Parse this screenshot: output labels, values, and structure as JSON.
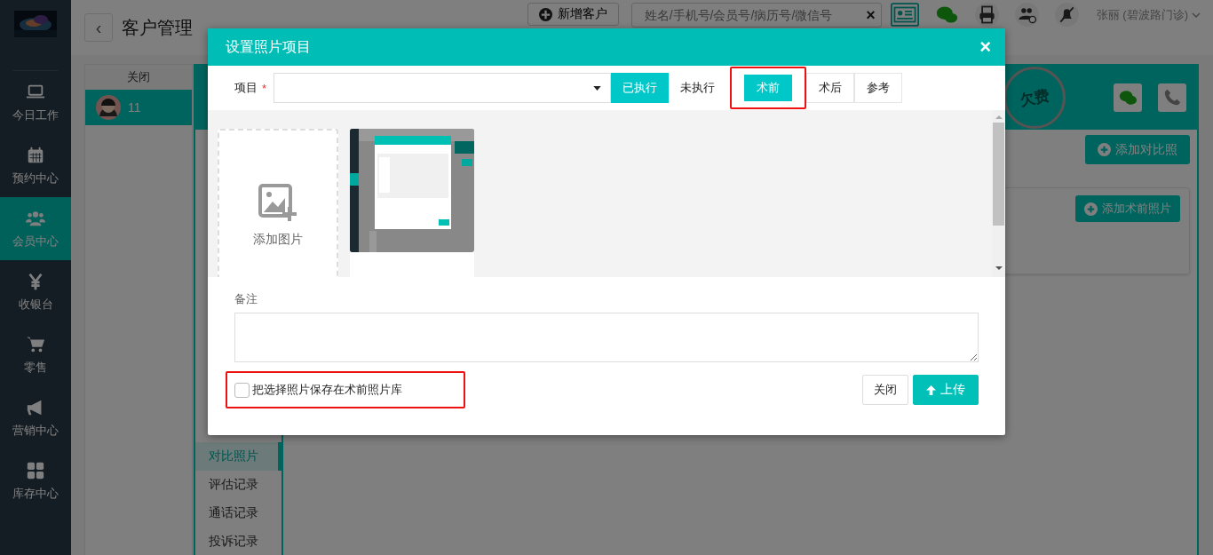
{
  "sidebar": {
    "items": [
      {
        "label": "今日工作",
        "selected": false
      },
      {
        "label": "预约中心",
        "selected": false
      },
      {
        "label": "会员中心",
        "selected": true
      },
      {
        "label": "收银台",
        "selected": false
      },
      {
        "label": "零售",
        "selected": false
      },
      {
        "label": "营销中心",
        "selected": false
      },
      {
        "label": "库存中心",
        "selected": false
      }
    ]
  },
  "header": {
    "back": "‹",
    "title": "客户管理",
    "new_button": "新增客户",
    "search": {
      "placeholder": "姓名/手机号/会员号/病历号/微信号",
      "clear": "×"
    },
    "user": "张丽 (碧波路门诊)"
  },
  "customer_list": {
    "header": "关闭",
    "rows": [
      {
        "name": "11",
        "selected": true
      }
    ]
  },
  "detail": {
    "stamp": "欠费",
    "tabs": [
      {
        "label": "对比照片",
        "selected": true
      },
      {
        "label": "评估记录",
        "selected": false
      },
      {
        "label": "通话记录",
        "selected": false
      },
      {
        "label": "投诉记录",
        "selected": false
      }
    ],
    "add_compare_button": "添加对比照",
    "add_before_button": "添加术前照片"
  },
  "dialog": {
    "title": "设置照片项目",
    "close": "×",
    "project": {
      "label": "项目",
      "required_mark": "*"
    },
    "status_options": [
      {
        "label": "已执行",
        "selected": true
      },
      {
        "label": "未执行",
        "selected": false
      }
    ],
    "phase_options": [
      {
        "label": "术前",
        "selected": true,
        "highlighted": true
      },
      {
        "label": "术后",
        "selected": false,
        "highlighted": false
      },
      {
        "label": "参考",
        "selected": false,
        "highlighted": false
      }
    ],
    "gallery": {
      "add_label": "添加图片"
    },
    "note": {
      "label": "备注"
    },
    "save_checkbox": {
      "label": "把选择照片保存在术前照片库",
      "checked": false,
      "highlighted": true
    },
    "buttons": [
      {
        "label": "关闭",
        "kind": "default"
      },
      {
        "label": "上传",
        "kind": "upload"
      }
    ]
  }
}
